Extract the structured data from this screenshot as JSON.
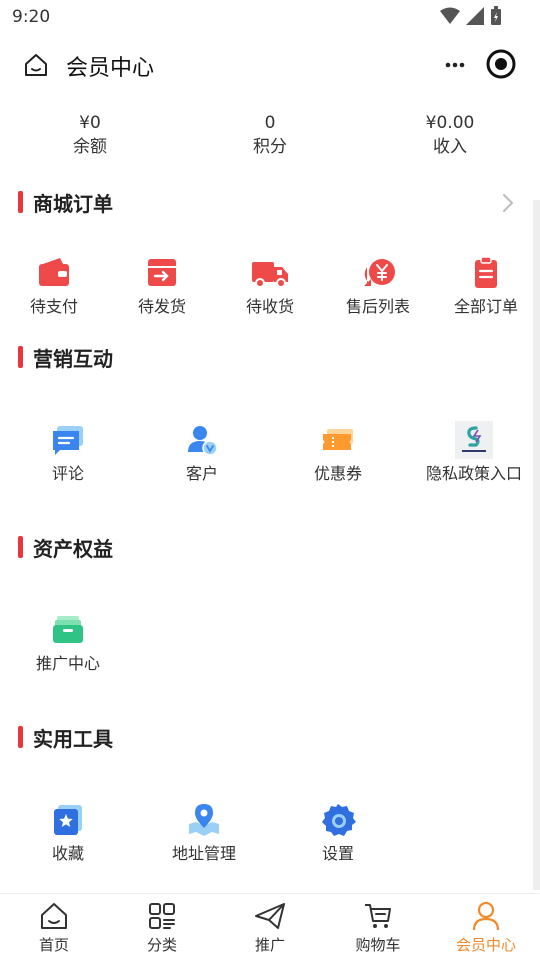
{
  "status_bar": {
    "time": "9:20"
  },
  "nav": {
    "title": "会员中心"
  },
  "stats": [
    {
      "value": "¥0",
      "label": "余额"
    },
    {
      "value": "0",
      "label": "积分"
    },
    {
      "value": "¥0.00",
      "label": "收入"
    }
  ],
  "orders": {
    "title": "商城订单",
    "items": [
      {
        "label": "待支付",
        "icon": "wallet-icon"
      },
      {
        "label": "待发货",
        "icon": "box-ship-icon"
      },
      {
        "label": "待收货",
        "icon": "truck-icon"
      },
      {
        "label": "售后列表",
        "icon": "refund-icon"
      },
      {
        "label": "全部订单",
        "icon": "clipboard-icon"
      }
    ]
  },
  "marketing": {
    "title": "营销互动",
    "items": [
      {
        "label": "评论",
        "icon": "comment-icon"
      },
      {
        "label": "客户",
        "icon": "customer-icon"
      },
      {
        "label": "优惠券",
        "icon": "coupon-icon"
      },
      {
        "label": "隐私政策入口",
        "icon": "privacy-logo-icon"
      }
    ]
  },
  "assets": {
    "title": "资产权益",
    "items": [
      {
        "label": "推广中心",
        "icon": "promo-box-icon"
      }
    ]
  },
  "tools": {
    "title": "实用工具",
    "items": [
      {
        "label": "收藏",
        "icon": "favorite-icon"
      },
      {
        "label": "地址管理",
        "icon": "map-pin-icon"
      },
      {
        "label": "设置",
        "icon": "gear-icon"
      }
    ]
  },
  "tabbar": {
    "active_color": "#f08a2c",
    "accent": "#e8363c",
    "tabs": [
      {
        "label": "首页",
        "icon": "home-icon"
      },
      {
        "label": "分类",
        "icon": "category-icon"
      },
      {
        "label": "推广",
        "icon": "paper-plane-icon"
      },
      {
        "label": "购物车",
        "icon": "cart-icon"
      },
      {
        "label": "会员中心",
        "icon": "user-icon",
        "active": true
      }
    ]
  }
}
